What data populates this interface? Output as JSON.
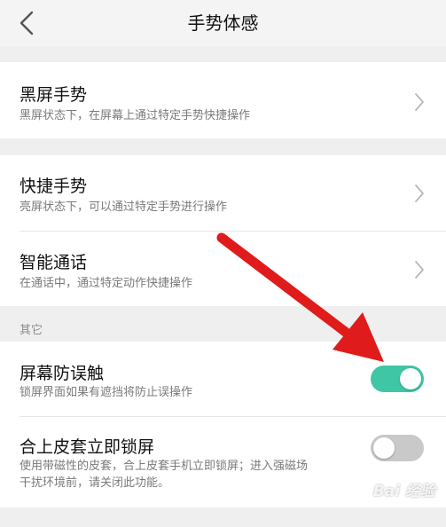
{
  "header": {
    "title": "手势体感"
  },
  "sections": {
    "black_screen": {
      "title": "黑屏手势",
      "subtitle": "黑屏状态下，在屏幕上通过特定手势快捷操作"
    },
    "quick_gesture": {
      "title": "快捷手势",
      "subtitle": "亮屏状态下，可以通过特定手势进行操作"
    },
    "smart_call": {
      "title": "智能通话",
      "subtitle": "在通话中，通过特定动作快捷操作"
    },
    "other_label": "其它",
    "mistouch": {
      "title": "屏幕防误触",
      "subtitle": "锁屏界面如果有遮挡将防止误操作",
      "enabled": true
    },
    "cover_lock": {
      "title": "合上皮套立即锁屏",
      "subtitle_line1": "使用带磁性的皮套，合上皮套手机立即锁屏；进入强磁场",
      "subtitle_line2": "干扰环境前，请关闭此功能。",
      "enabled": false
    }
  },
  "colors": {
    "toggle_on": "#3fc6a5",
    "toggle_off": "#c9c9c9",
    "annotation_arrow": "#e01b1b"
  },
  "icons": {
    "back": "chevron-left-icon",
    "row_arrow": "chevron-right-icon"
  },
  "watermark": "Bai 经验"
}
